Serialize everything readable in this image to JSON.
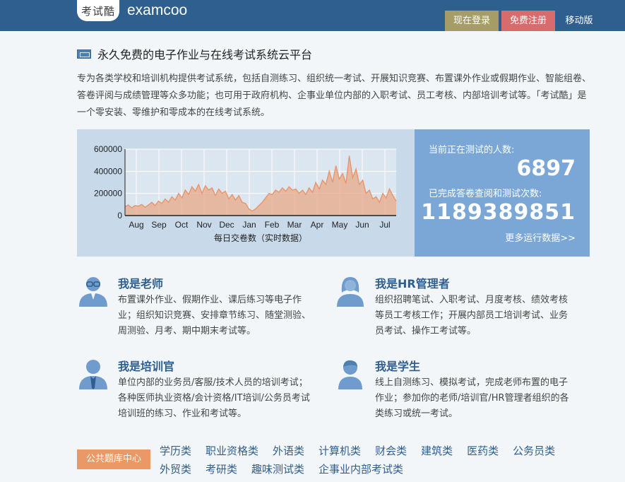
{
  "header": {
    "logo_badge": "考试酷",
    "logo_text": "examcoo",
    "login_label": "现在登录",
    "register_label": "免费注册",
    "mobile_label": "移动版"
  },
  "headline": "永久免费的电子作业与在线考试系统云平台",
  "intro": "专为各类学校和培训机构提供考试系统，包括自测练习、组织统一考试、开展知识竞赛、布置课外作业或假期作业、智能组卷、答卷评阅与成绩管理等众多功能；也可用于政府机构、企事业单位内部的入职考试、员工考核、内部培训考试等。「考试酷」是一个零安装、零维护和零成本的在线考试系统。",
  "stats": {
    "testing_label": "当前正在测试的人数:",
    "testing_value": "6897",
    "completed_label": "已完成答卷查阅和测试次数:",
    "completed_value": "1189389851",
    "more_label": "更多运行数据>>"
  },
  "chart_data": {
    "type": "area",
    "xlabel": "每日交卷数（实时数据）",
    "ylim": [
      0,
      600000
    ],
    "y_ticks": [
      "0",
      "200000",
      "400000",
      "600000"
    ],
    "x_ticks": [
      "Aug",
      "Sep",
      "Oct",
      "Nov",
      "Dec",
      "Jan",
      "Feb",
      "Mar",
      "Apr",
      "May",
      "Jun",
      "Jul"
    ],
    "grid": true,
    "values": [
      80000,
      95000,
      70000,
      90000,
      85000,
      100000,
      75000,
      95000,
      120000,
      90000,
      130000,
      110000,
      150000,
      120000,
      170000,
      140000,
      200000,
      160000,
      230000,
      190000,
      260000,
      220000,
      280000,
      200000,
      270000,
      230000,
      250000,
      180000,
      240000,
      200000,
      220000,
      150000,
      190000,
      140000,
      180000,
      120000,
      110000,
      60000,
      40000,
      60000,
      90000,
      120000,
      160000,
      200000,
      190000,
      230000,
      210000,
      250000,
      220000,
      260000,
      230000,
      240000,
      200000,
      230000,
      190000,
      250000,
      210000,
      300000,
      240000,
      320000,
      280000,
      400000,
      300000,
      450000,
      330000,
      380000,
      290000,
      540000,
      340000,
      420000,
      280000,
      320000,
      200000,
      230000,
      150000,
      170000,
      120000,
      200000,
      160000,
      240000,
      180000,
      130000
    ]
  },
  "roles": [
    {
      "title": "我是老师",
      "desc": "布置课外作业、假期作业、课后练习等电子作业；组织知识竞赛、安排章节练习、随堂测验、周测验、月考、期中期末考试等。"
    },
    {
      "title": "我是HR管理者",
      "desc": "组织招聘笔试、入职考试、月度考核、绩效考核等员工考核工作；开展内部员工培训考试、业务员考试、操作工考试等。"
    },
    {
      "title": "我是培训官",
      "desc": "单位内部的业务员/客服/技术人员的培训考试；各种医师执业资格/会计资格/IT培训/公务员考试培训班的练习、作业和考试等。"
    },
    {
      "title": "我是学生",
      "desc": "线上自测练习、模拟考试，完成老师布置的电子作业；参加你的老师/培训官/HR管理者组织的各类练习或统一考试。"
    }
  ],
  "categories": {
    "badge": "公共题库中心",
    "links": [
      "学历类",
      "职业资格类",
      "外语类",
      "计算机类",
      "财会类",
      "建筑类",
      "医药类",
      "公务员类",
      "外贸类",
      "考研类",
      "趣味测试类",
      "企事业内部考试类"
    ]
  },
  "colors": {
    "header_bg": "#2f5f8e",
    "login_bg": "#a59c68",
    "register_bg": "#d86c6c",
    "chart_bg": "#c8d9ea",
    "counter_bg": "#7aa7d6",
    "area_fill": "#e8a887",
    "area_line": "#e8956a",
    "badge_bg": "#e99866"
  }
}
